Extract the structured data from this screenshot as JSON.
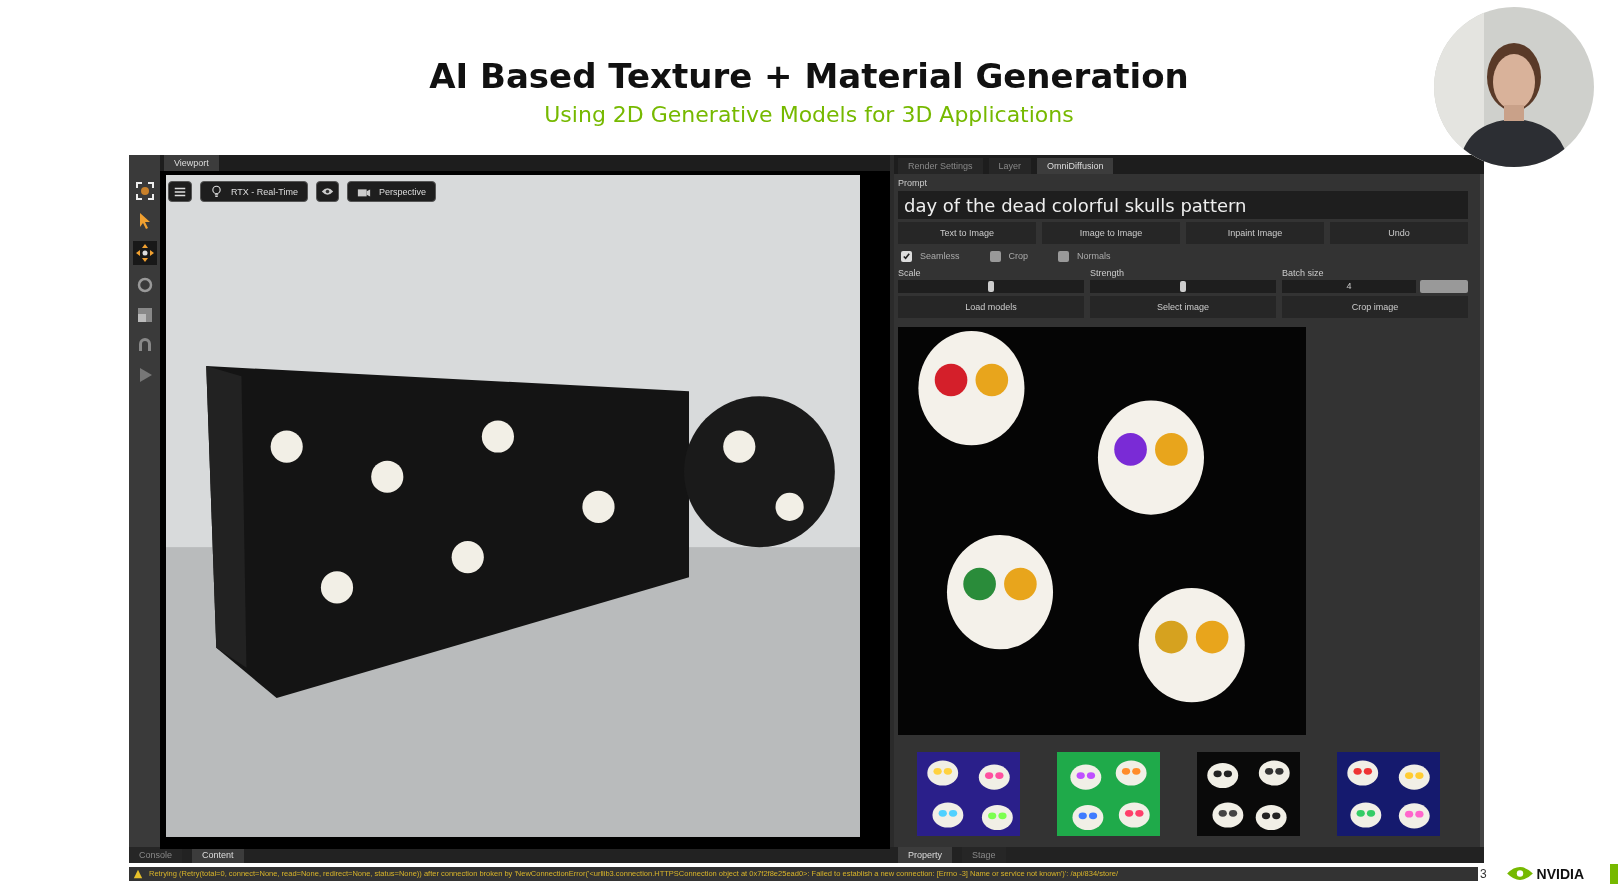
{
  "slide": {
    "title": "AI Based Texture + Material Generation",
    "subtitle": "Using 2D Generative Models for 3D Applications",
    "page_number": "3",
    "logo": "NVIDIA"
  },
  "viewport": {
    "tab": "Viewport",
    "render_button": "RTX - Real-Time",
    "camera_button": "Perspective"
  },
  "panel": {
    "tabs": [
      {
        "label": "Render Settings",
        "selected": false
      },
      {
        "label": "Layer",
        "selected": false
      },
      {
        "label": "OmniDiffusion",
        "selected": true
      }
    ],
    "prompt_label": "Prompt",
    "prompt": "day of the dead colorful skulls pattern",
    "actions": [
      "Text to Image",
      "Image to Image",
      "Inpaint Image",
      "Undo"
    ],
    "options": [
      {
        "label": "Seamless",
        "checked": true
      },
      {
        "label": "Crop",
        "checked": false
      },
      {
        "label": "Normals",
        "checked": false
      }
    ],
    "sliders": [
      {
        "label": "Scale",
        "level": 0.5
      },
      {
        "label": "Strength",
        "level": 0.5
      }
    ],
    "batch": {
      "label": "Batch size",
      "value": "4"
    },
    "buttons": [
      "Load models",
      "Select image",
      "Crop image"
    ]
  },
  "bottom_tabs_left": [
    {
      "label": "Console",
      "selected": false
    },
    {
      "label": "Content",
      "selected": true
    }
  ],
  "bottom_tabs_right": [
    {
      "label": "Property",
      "selected": true
    },
    {
      "label": "Stage",
      "selected": false
    }
  ],
  "status_bar": {
    "message": "Retrying (Retry(total=0, connect=None, read=None, redirect=None, status=None)) after connection broken by 'NewConnectionError('<urllib3.connection.HTTPSConnection object at 0x7f2f8e25ead0>: Failed to establish a new connection: [Errno -3] Name or service not known')': /api/834/store/"
  }
}
